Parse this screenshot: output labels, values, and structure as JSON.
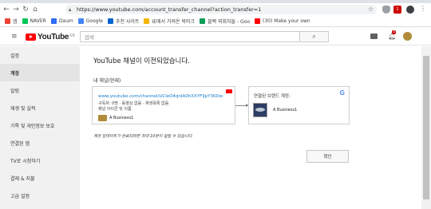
{
  "browser": {
    "url": "https://www.youtube.com/account_transfer_channel?action_transfer=1",
    "back_icon": "←",
    "forward_icon": "→",
    "reload_icon": "↻",
    "home_icon": "⌂",
    "star_icon": "☆",
    "menu_icon": "⋮",
    "badge": "1"
  },
  "bookmarks": [
    {
      "label": "앱",
      "color": "#ea4335"
    },
    {
      "label": "NAVER",
      "color": "#03c75a"
    },
    {
      "label": "Daum",
      "color": "#2f6cf5"
    },
    {
      "label": "Google",
      "color": "#4285f4"
    },
    {
      "label": "추천 사이트",
      "color": "#0066cc"
    },
    {
      "label": "IE에서 가져온 북마크",
      "color": "#f4b400"
    },
    {
      "label": "블랙 외회자들 - Goo",
      "color": "#0f9d58"
    },
    {
      "label": "(30) Make your own",
      "color": "#ff0000"
    }
  ],
  "youtube_header": {
    "menu_icon": "≡",
    "wordmark": "YouTube",
    "region": "KR",
    "search_placeholder": "검색",
    "search_icon": "⌕",
    "bell_icon": "♪",
    "notification_count": "3"
  },
  "sidebar": {
    "items": [
      {
        "label": "설정",
        "active": false
      },
      {
        "label": "계정",
        "active": true
      },
      {
        "label": "알림",
        "active": false
      },
      {
        "label": "재생 및 실적",
        "active": false
      },
      {
        "label": "기록 및 개인정보 보호",
        "active": false
      },
      {
        "label": "연결된 앱",
        "active": false
      },
      {
        "label": "TV로 시청하기",
        "active": false
      },
      {
        "label": "결제 & 지불",
        "active": false
      },
      {
        "label": "고급 설정",
        "active": false
      }
    ]
  },
  "main": {
    "title": "YouTube 채널이 이전되었습니다.",
    "section_label": "내 채널(현재)",
    "old_channel": {
      "url": "www.youtube.com/channel/UCleO4qnIA0hXXYFIJpY36Dw",
      "meta_line1": "구독자: 0명 · 동영상 없음 · 재생목록 없음",
      "meta_line2": "채널 아이콘 및 이름",
      "name": "A Business1"
    },
    "new_account": {
      "label": "연결된 브랜드 계정:",
      "google_letter": "G",
      "name": "A Business1"
    },
    "notice": "계정 업데이트가 완료되려면 최대 10분이 걸릴 수 있습니다.",
    "ok_button": "확인"
  }
}
